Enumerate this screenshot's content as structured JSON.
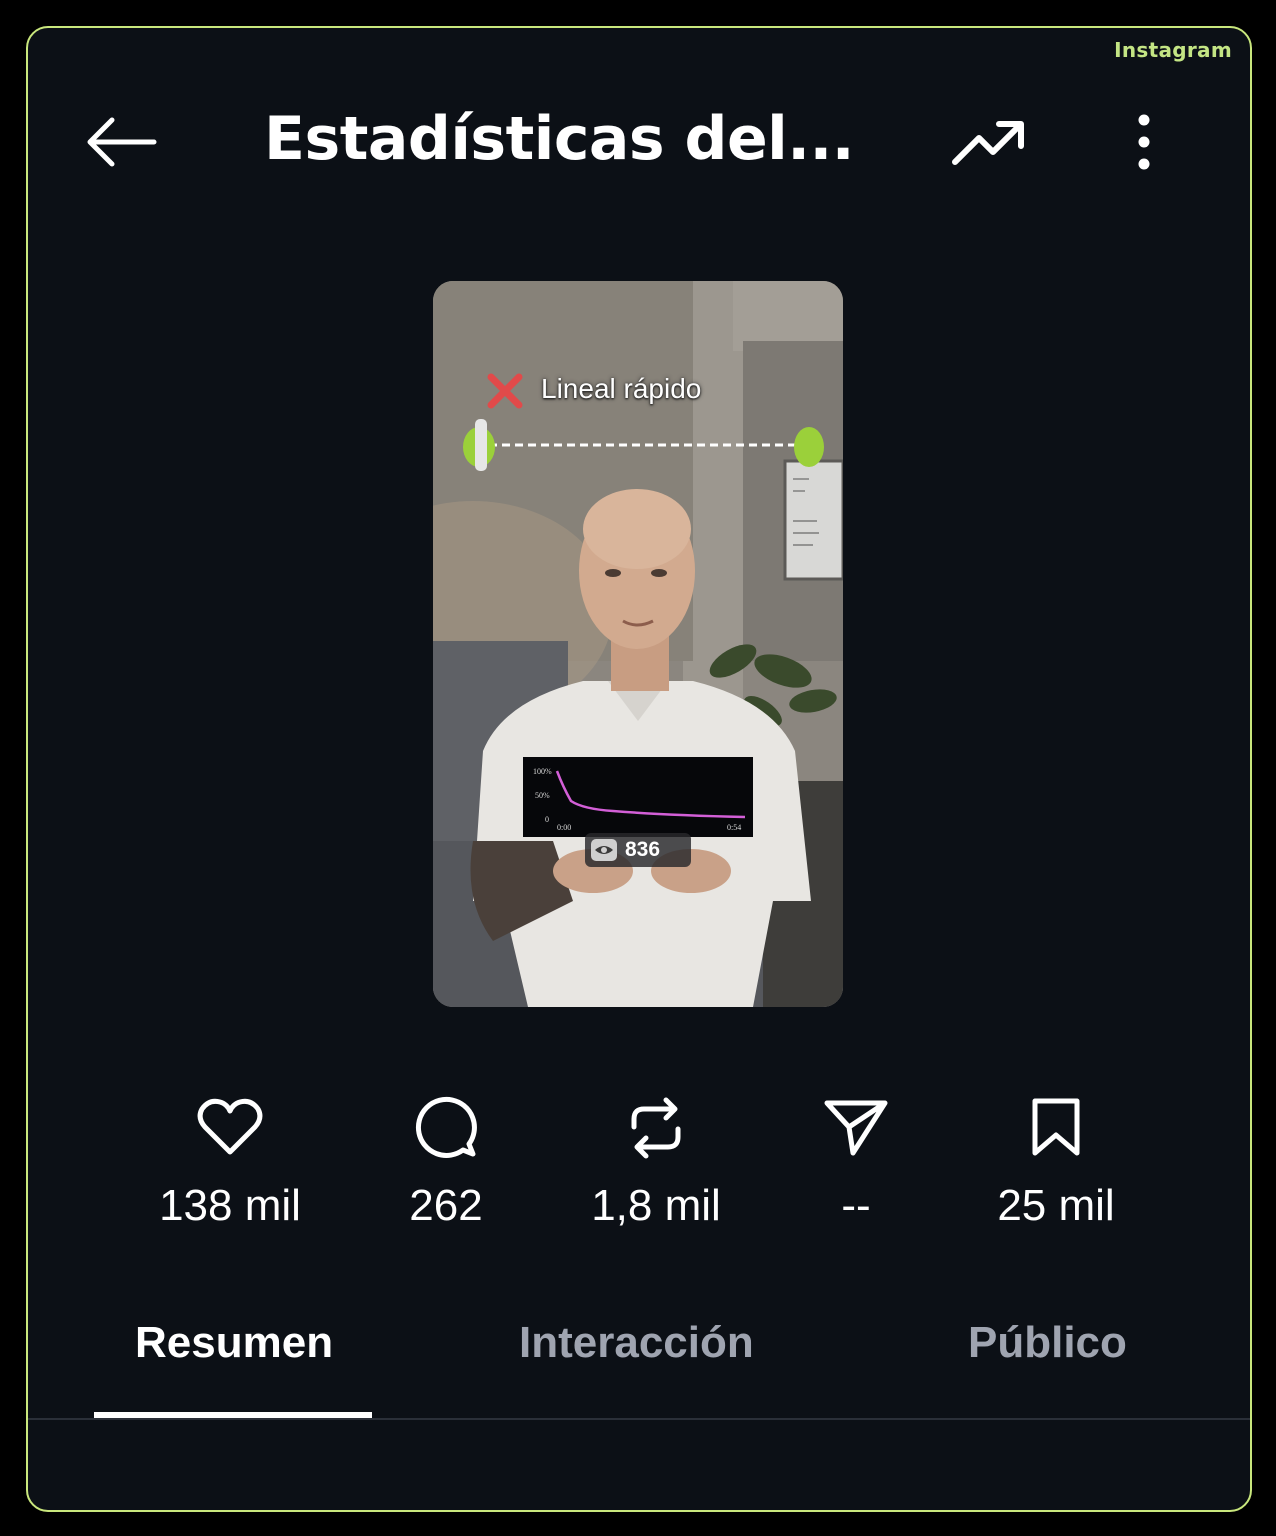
{
  "brand": "Instagram",
  "header": {
    "title": "Estadísticas del...",
    "back_icon": "arrow-left-icon",
    "trend_icon": "trending-up-icon",
    "more_icon": "more-vertical-icon"
  },
  "thumbnail": {
    "overlay_text": "Lineal rápido",
    "views": "836",
    "chart_labels": {
      "y_top": "100%",
      "y_mid": "50%",
      "y_zero": "0",
      "x_start": "0:00",
      "x_end": "0:54"
    }
  },
  "stats": [
    {
      "icon": "heart-icon",
      "value": "138 mil"
    },
    {
      "icon": "comment-icon",
      "value": "262"
    },
    {
      "icon": "repost-icon",
      "value": "1,8 mil"
    },
    {
      "icon": "send-icon",
      "value": "--"
    },
    {
      "icon": "bookmark-icon",
      "value": "25 mil"
    }
  ],
  "tabs": [
    {
      "label": "Resumen",
      "active": true
    },
    {
      "label": "Interacción",
      "active": false
    },
    {
      "label": "Público",
      "active": false
    }
  ],
  "colors": {
    "background": "#0c1016",
    "frame_border": "#c9e77d",
    "brand_text": "#c4e584",
    "inactive_tab": "#9fa4b0"
  }
}
